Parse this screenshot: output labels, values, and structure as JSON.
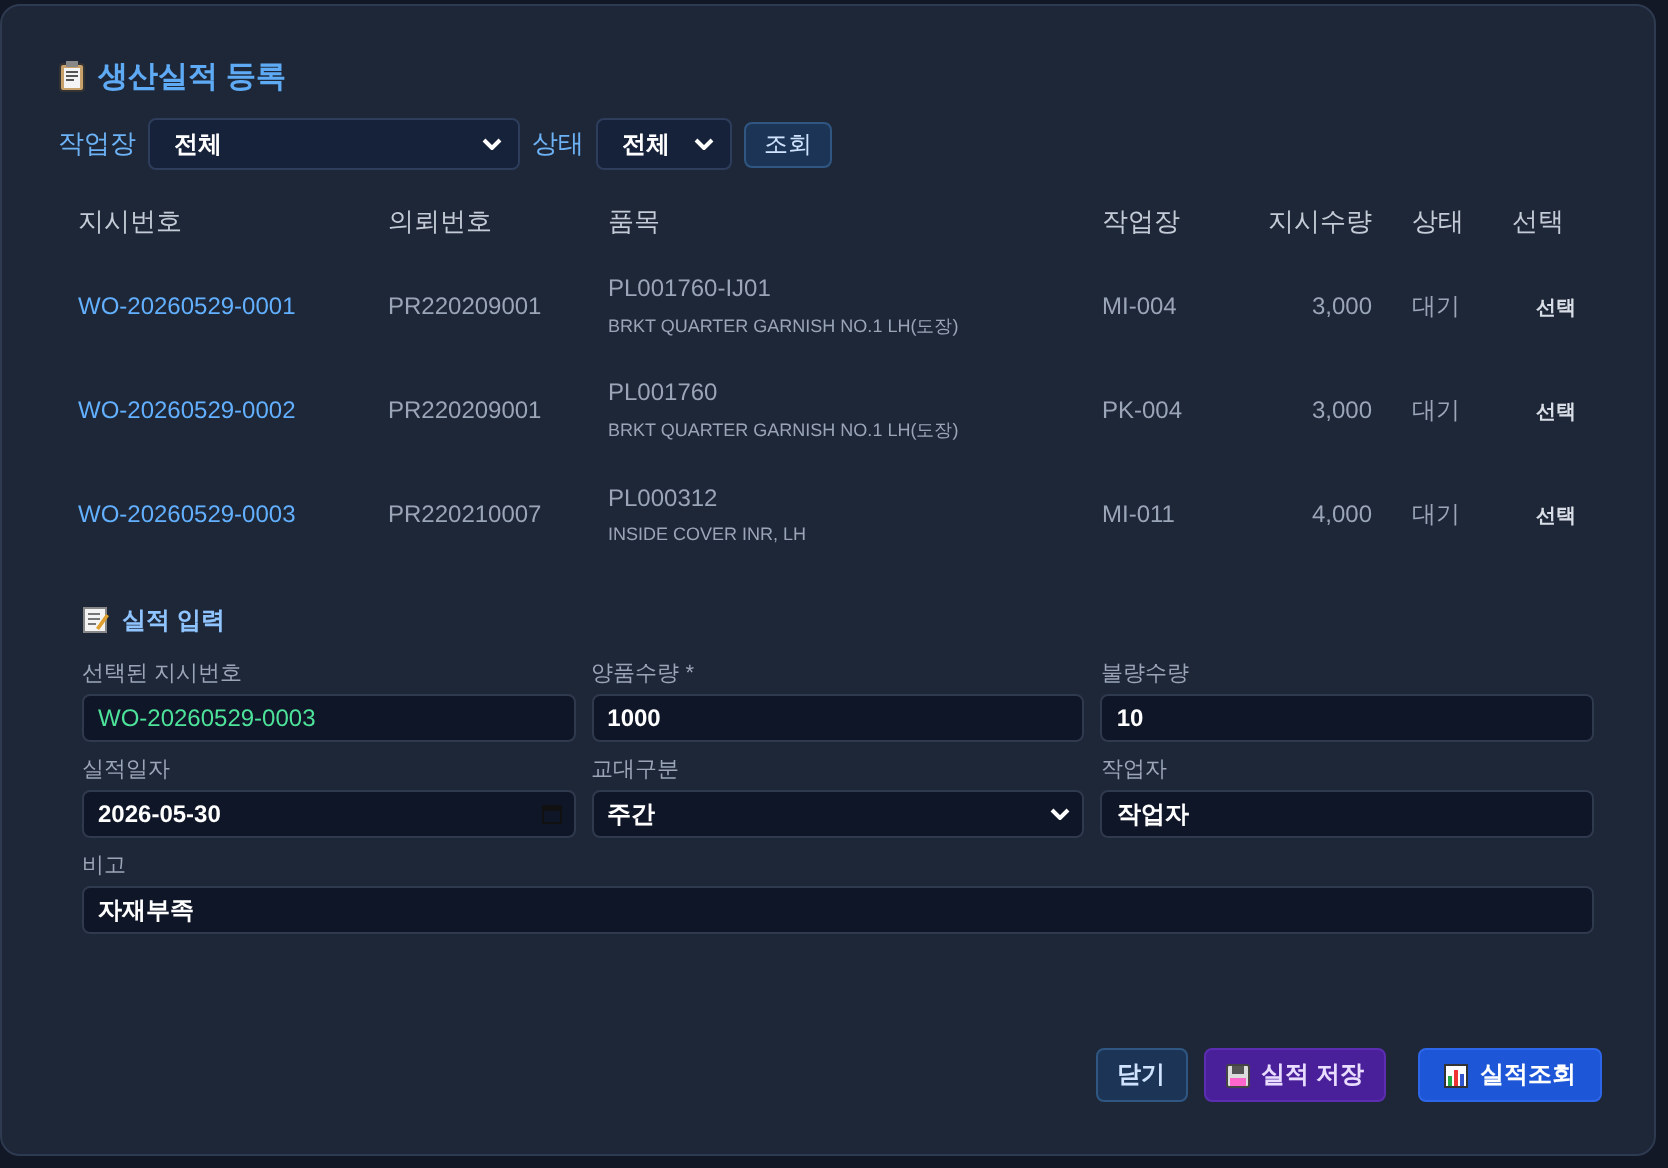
{
  "title": "생산실적 등록",
  "filters": [
    {
      "kind": "select",
      "label": "작업장",
      "value": "전체"
    },
    {
      "kind": "select",
      "label": "상태",
      "value": "전체"
    }
  ],
  "search_button": "조회",
  "table": {
    "columns": [
      "지시번호",
      "의뢰번호",
      "품목",
      "작업장",
      "지시수량",
      "상태",
      "선택"
    ],
    "rows": [
      {
        "order_no": "WO-20260529-0001",
        "request_no": "PR220209001",
        "item_code": "PL001760-IJ01",
        "item_name": "BRKT QUARTER GARNISH NO.1 LH(도장)",
        "workplace": "MI-004",
        "quantity": "3,000",
        "status": "대기",
        "action": "선택"
      },
      {
        "order_no": "WO-20260529-0002",
        "request_no": "PR220209001",
        "item_code": "PL001760",
        "item_name": "BRKT QUARTER GARNISH NO.1 LH(도장)",
        "workplace": "PK-004",
        "quantity": "3,000",
        "status": "대기",
        "action": "선택"
      },
      {
        "order_no": "WO-20260529-0003",
        "request_no": "PR220210007",
        "item_code": "PL000312",
        "item_name": "INSIDE COVER INR, LH",
        "workplace": "MI-011",
        "quantity": "4,000",
        "status": "대기",
        "action": "선택"
      }
    ]
  },
  "form": {
    "title": "실적 입력",
    "fields": [
      {
        "kind": "readonly",
        "label": "선택된 지시번호",
        "value": "WO-20260529-0003"
      },
      {
        "kind": "text",
        "label": "양품수량 *",
        "value": "1000"
      },
      {
        "kind": "text",
        "label": "불량수량",
        "value": "10"
      },
      {
        "kind": "date",
        "label": "실적일자",
        "value": "2026-05-30"
      },
      {
        "kind": "select",
        "label": "교대구분",
        "value": "주간"
      },
      {
        "kind": "text",
        "label": "작업자",
        "value": "작업자"
      },
      {
        "kind": "wide",
        "label": "비고",
        "value": "자재부족"
      }
    ]
  },
  "buttons": [
    {
      "kind": "close",
      "label": "닫기"
    },
    {
      "kind": "save",
      "label": "실적 저장"
    },
    {
      "kind": "view",
      "label": "실적조회"
    }
  ]
}
